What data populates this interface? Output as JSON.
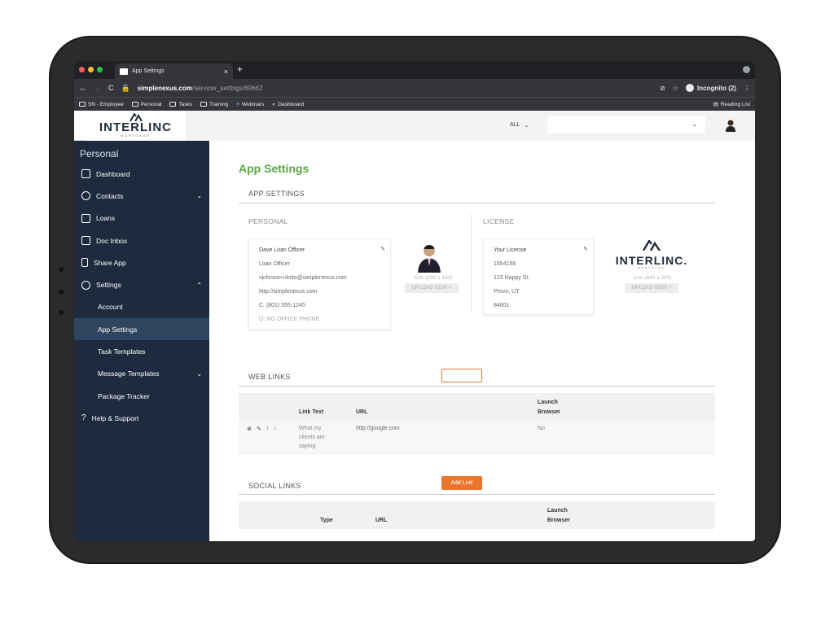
{
  "browser": {
    "tab_title": "App Settings",
    "tab_close": "×",
    "new_tab": "+",
    "url_host": "simplenexus.com",
    "url_path": "/servicer_settings/69662",
    "incognito": "Incognito (2)",
    "bookmarks": [
      "SN - Employee",
      "Personal",
      "Tasks",
      "Training",
      "Webinars",
      "Dashboard"
    ],
    "reading_list": "Reading List"
  },
  "header": {
    "logo_text": "INTERLINC",
    "logo_sub": "MORTGAGE",
    "scope": "ALL",
    "scope_chevron": "⌄",
    "search_chevron": "⌄"
  },
  "sidebar": {
    "title": "Personal",
    "items": [
      {
        "label": "Dashboard"
      },
      {
        "label": "Contacts",
        "chevron": "⌄"
      },
      {
        "label": "Loans"
      },
      {
        "label": "Doc Inbox"
      },
      {
        "label": "Share App"
      },
      {
        "label": "Settings",
        "chevron": "⌃"
      },
      {
        "label": "Account"
      },
      {
        "label": "App Settings"
      },
      {
        "label": "Task Templates"
      },
      {
        "label": "Message Templates",
        "chevron": "⌄"
      },
      {
        "label": "Package Tracker"
      },
      {
        "label": "Help & Support"
      }
    ]
  },
  "main": {
    "page_title": "App Settings",
    "section_app": "APP SETTINGS",
    "personal_head": "PERSONAL",
    "license_head": "LICENSE",
    "personal_card": {
      "name": "Dave Loan Officer",
      "role": "Loan Officer",
      "email": "sjohnson+ilmlo@simplenexus.com",
      "site": "http://simplenexus.com",
      "cell": "C: (801) 555-1245",
      "office": "O: NO OFFICE PHONE"
    },
    "photo_note": "Icon (192 x 192)",
    "photo_upload": "UPLOAD NEW +",
    "license_card": {
      "title": "Your License",
      "number": "1654156",
      "street": "123 Happy St.",
      "city": "Provo, UT",
      "zip": "84601"
    },
    "license_logo_text": "INTERLINC.",
    "license_logo_sub": "MORTGAGE",
    "license_note": "Icon (640 x 200)",
    "license_upload": "UPLOAD NEW +",
    "web_links": {
      "head": "WEB LINKS",
      "columns": [
        "Link Text",
        "URL",
        "Launch",
        "Browser"
      ],
      "rows": [
        {
          "text_1": "What my",
          "text_2": "clients are",
          "text_3": "saying",
          "url": "http://google.com",
          "launch": "No"
        }
      ]
    },
    "social_links": {
      "head": "SOCIAL LINKS",
      "add_button": "Add Link",
      "columns": [
        "Type",
        "URL",
        "Launch",
        "Browser"
      ]
    }
  },
  "colors": {
    "accent_green": "#5aa542",
    "accent_orange": "#e8762d",
    "sidebar_bg": "#1e2b3e",
    "sidebar_active": "#2f4560"
  }
}
